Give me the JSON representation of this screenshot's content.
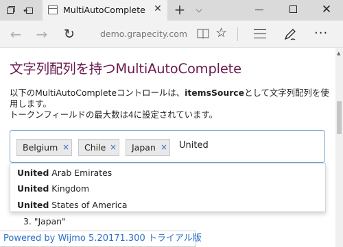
{
  "browser": {
    "tab_title": "MultiAutoComplete",
    "address": "demo.grapecity.com/w"
  },
  "page": {
    "title": "文字列配列を持つMultiAutoComplete",
    "desc_part1": "以下のMultiAutoCompleteコントロールは、",
    "desc_bold": "itemsSource",
    "desc_part2": "として文字列配列を使",
    "desc_part3": "用します。",
    "desc_line2": "トークンフィールドの最大数は4に設定されています。"
  },
  "multi_auto_complete": {
    "tokens": [
      "Belgium",
      "Chile",
      "Japan"
    ],
    "remove_glyph": "×",
    "input_value": "United"
  },
  "suggestions": [
    {
      "match": "United",
      "rest": " Arab Emirates"
    },
    {
      "match": "United",
      "rest": " Kingdom"
    },
    {
      "match": "United",
      "rest": " States of America"
    }
  ],
  "selected_list": {
    "item_3": "3.  \"Japan\""
  },
  "footer": {
    "banner": "Powered by Wijmo 5.20171.300 トライアル版"
  }
}
